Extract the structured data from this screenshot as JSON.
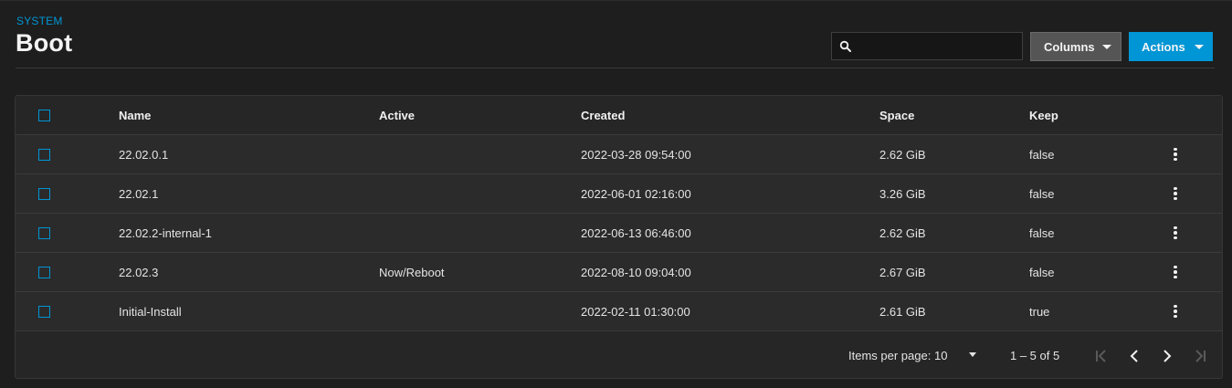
{
  "header": {
    "breadcrumb": "SYSTEM",
    "title": "Boot"
  },
  "toolbar": {
    "search_placeholder": "",
    "search_value": "",
    "columns_label": "Columns",
    "actions_label": "Actions"
  },
  "table": {
    "columns": [
      "Name",
      "Active",
      "Created",
      "Space",
      "Keep"
    ],
    "rows": [
      {
        "name": "22.02.0.1",
        "active": "",
        "created": "2022-03-28 09:54:00",
        "space": "2.62 GiB",
        "keep": "false"
      },
      {
        "name": "22.02.1",
        "active": "",
        "created": "2022-06-01 02:16:00",
        "space": "3.26 GiB",
        "keep": "false"
      },
      {
        "name": "22.02.2-internal-1",
        "active": "",
        "created": "2022-06-13 06:46:00",
        "space": "2.62 GiB",
        "keep": "false"
      },
      {
        "name": "22.02.3",
        "active": "Now/Reboot",
        "created": "2022-08-10 09:04:00",
        "space": "2.67 GiB",
        "keep": "false"
      },
      {
        "name": "Initial-Install",
        "active": "",
        "created": "2022-02-11 01:30:00",
        "space": "2.61 GiB",
        "keep": "true"
      }
    ]
  },
  "paginator": {
    "items_per_page_label": "Items per page:",
    "page_size": "10",
    "range_label": "1 – 5 of 5"
  },
  "colors": {
    "accent": "#0095d5",
    "background": "#1e1e1e",
    "card": "#262626",
    "row": "#2b2b2b"
  }
}
